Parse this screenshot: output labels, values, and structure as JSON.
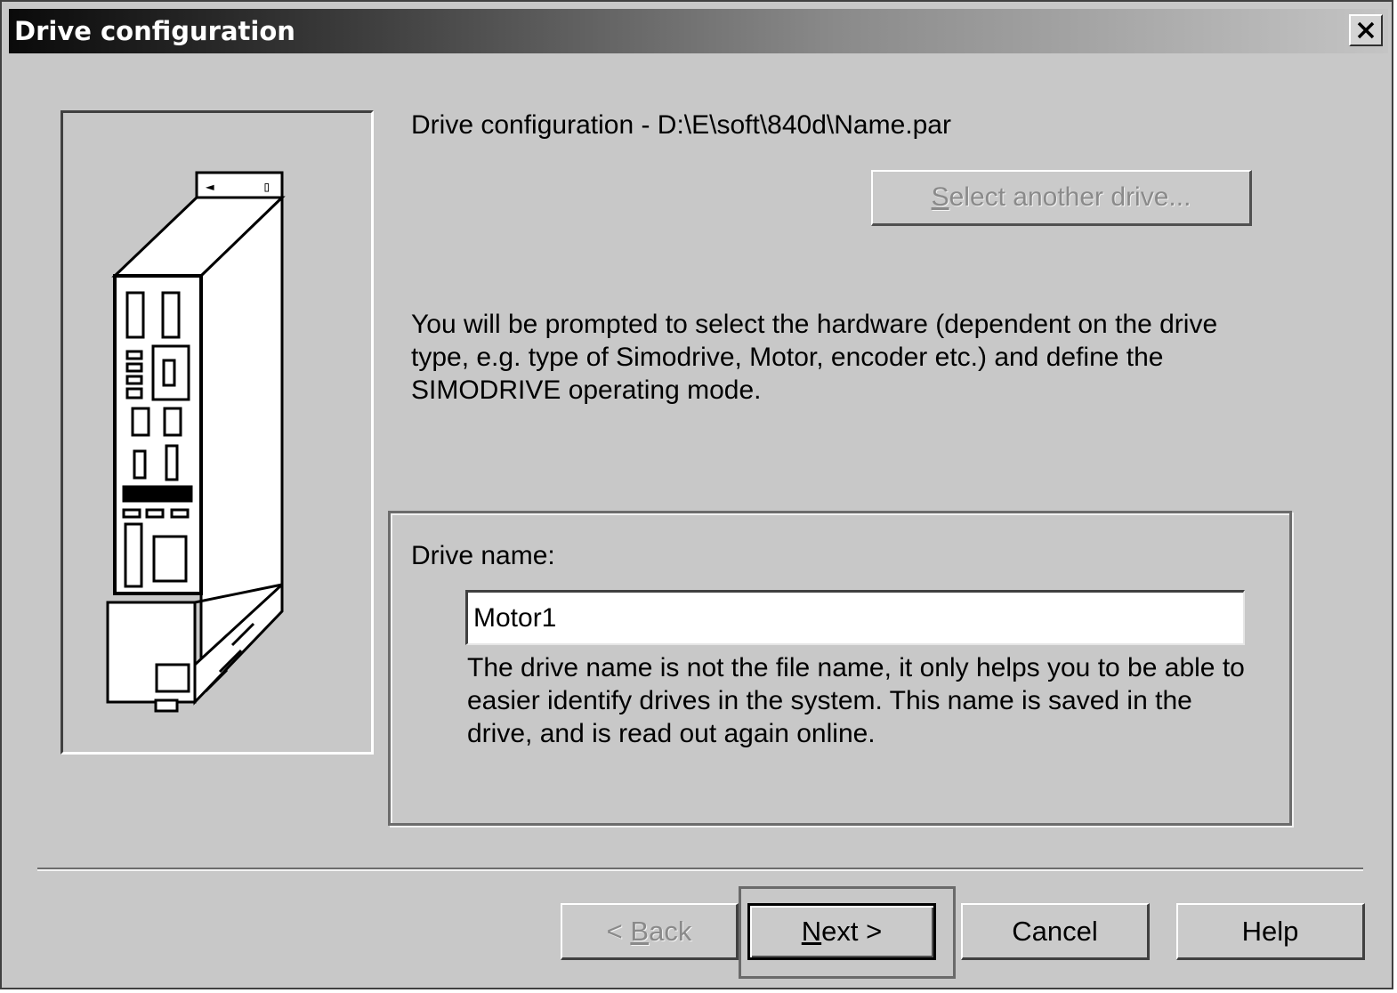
{
  "window": {
    "title": "Drive configuration",
    "close_glyph": "✕"
  },
  "header": {
    "path_label": "Drive configuration - D:\\E\\soft\\840d\\Name.par"
  },
  "select_drive": {
    "label_mnemonic": "S",
    "label_rest": "elect another drive..."
  },
  "prompt": {
    "text": "You will be prompted to select the hardware (dependent on the drive type, e.g. type of Simodrive, Motor, encoder etc.) and define the SIMODRIVE operating mode."
  },
  "drive_name": {
    "label": "Drive name:",
    "value": "Motor1",
    "help": "The drive name is not the file name, it only helps you to be able to easier identify drives in the system. This name is saved in the drive, and is read out again online."
  },
  "buttons": {
    "back_prefix": "< ",
    "back_mnemonic": "B",
    "back_rest": "ack",
    "next_mnemonic": "N",
    "next_rest": "ext >",
    "cancel": "Cancel",
    "help": "Help"
  },
  "illustration": {
    "icon": "simodrive-module-icon"
  }
}
